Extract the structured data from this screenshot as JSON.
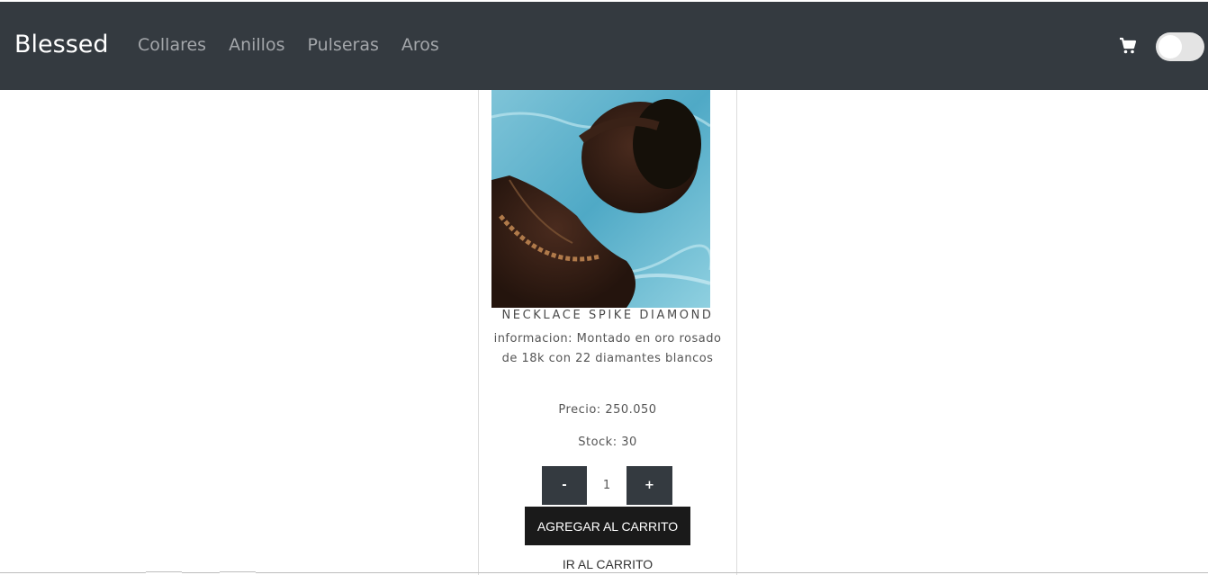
{
  "navbar": {
    "brand": "Blessed",
    "links": [
      "Collares",
      "Anillos",
      "Pulseras",
      "Aros"
    ],
    "cart_icon": "cart-icon",
    "theme_toggle": "off"
  },
  "product": {
    "image_alt": "woman floating in water wearing necklace",
    "title": "NECKLACE SPIKE DIAMOND",
    "info": "informacion: Montado en oro rosado de 18k con 22 diamantes blancos",
    "price": "Precio: 250.050",
    "stock": "Stock: 30",
    "quantity": {
      "minus_label": "-",
      "value": "1",
      "plus_label": "+"
    },
    "add_to_cart_label": "AGREGAR AL CARRITO",
    "go_to_cart_label": "IR AL CARRITO"
  },
  "colors": {
    "navbar_bg": "#343a40",
    "button_dark": "#1a1a1a"
  }
}
